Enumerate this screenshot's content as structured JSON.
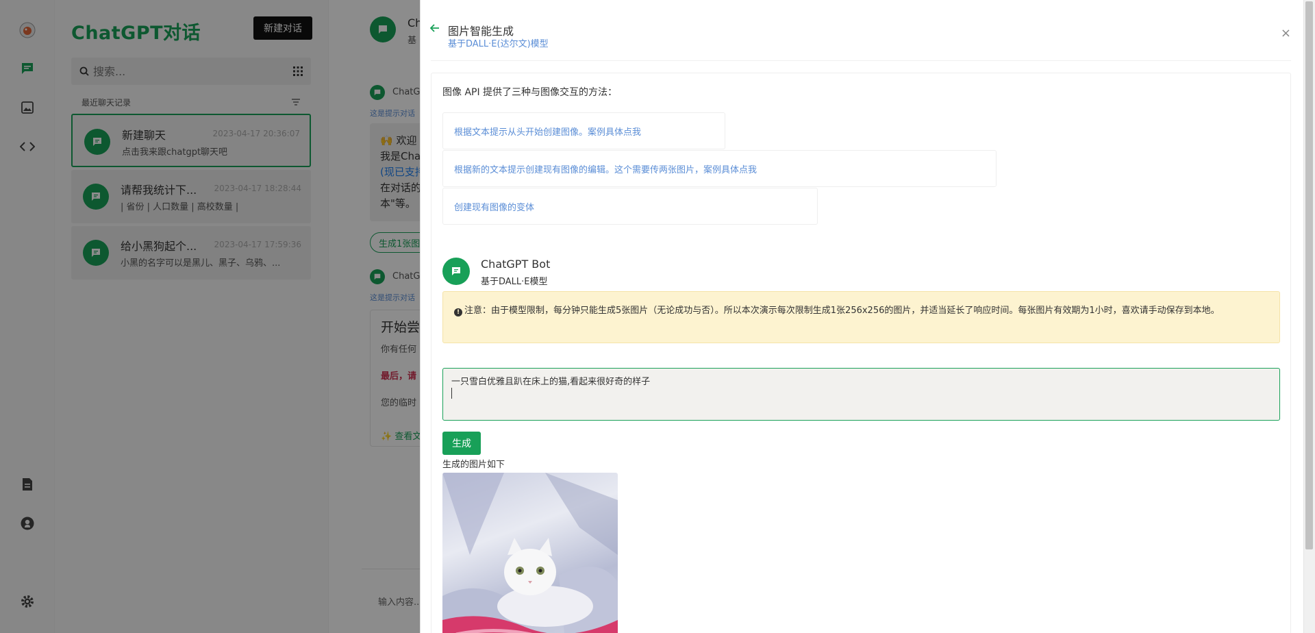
{
  "sidebar": {
    "title": "ChatGPT对话",
    "new_chat_label": "新建对话",
    "search_placeholder": "搜索...",
    "recent_label": "最近聊天记录",
    "items": [
      {
        "title": "新建聊天",
        "date": "2023-04-17 20:36:07",
        "preview": "点击我来跟chatgpt聊天吧"
      },
      {
        "title": "请帮我统计下...",
        "date": "2023-04-17 18:28:44",
        "preview": "| 省份 | 人口数量 | 高校数量 |"
      },
      {
        "title": "给小黑狗起个...",
        "date": "2023-04-17 17:59:36",
        "preview": "小黑的名字可以是黑儿、黑子、乌鸦、..."
      }
    ]
  },
  "main": {
    "header_title": "Ch",
    "header_sub": "基",
    "msg1_name": "ChatG",
    "msg1_hint": "这是提示对话",
    "bubble1": {
      "line1": "🙌 欢迎",
      "line2": "我是Cha",
      "line3": "(现已支持",
      "line4": "在对话的",
      "line5": "本\"等。"
    },
    "gen_pill": "生成1张图",
    "msg2_name": "ChatG",
    "msg2_hint": "这是提示对话",
    "card2": {
      "heading": "开始尝",
      "line1": "你有任何",
      "line2": "最后，请",
      "line3": "您的临时",
      "line4": "✨ 查看文"
    },
    "input_placeholder": "输入内容..."
  },
  "drawer": {
    "back_icon": "arrow-left",
    "title": "图片智能生成",
    "subtitle": "基于DALL·E(达尔文)模型",
    "close": "×",
    "intro": "图像 API 提供了三种与图像交互的方法：",
    "options": [
      "根据文本提示从头开始创建图像。案例具体点我",
      "根据新的文本提示创建现有图像的编辑。这个需要传两张图片，案例具体点我",
      "创建现有图像的变体"
    ],
    "bot_name": "ChatGPT Bot",
    "bot_model": "基于DALL·E模型",
    "warning": "注意：由于模型限制，每分钟只能生成5张图片（无论成功与否）。所以本次演示每次限制生成1张256x256的图片，并适当延长了响应时间。每张图片有效期为1小时，喜欢请手动保存到本地。",
    "prompt_value": "一只雪白优雅且趴在床上的猫,看起来很好奇的样子",
    "generate_label": "生成",
    "result_label": "生成的图片如下"
  },
  "colors": {
    "accent": "#18a058",
    "link": "#5a8dd6",
    "warning_bg": "#fdf3d0"
  }
}
